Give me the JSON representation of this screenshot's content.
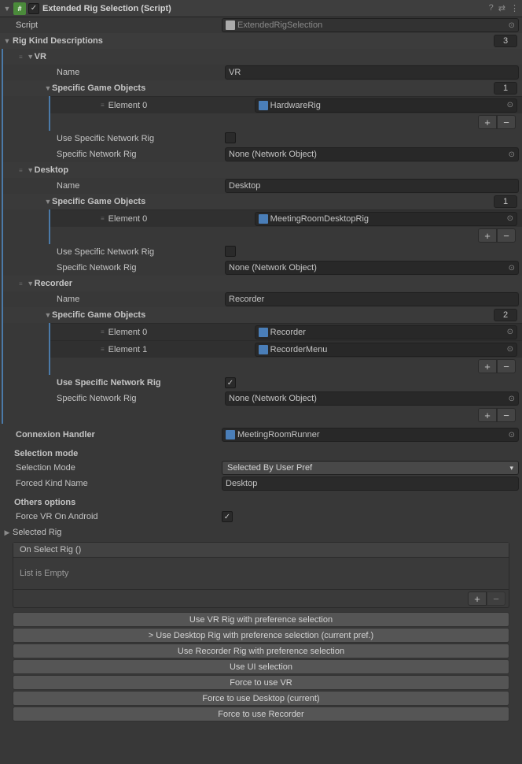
{
  "header": {
    "title": "Extended Rig Selection (Script)"
  },
  "script": {
    "label": "Script",
    "value": "ExtendedRigSelection"
  },
  "rigKinds": {
    "label": "Rig Kind Descriptions",
    "count": "3",
    "items": [
      {
        "title": "VR",
        "name_label": "Name",
        "name_value": "VR",
        "sgo_label": "Specific Game Objects",
        "sgo_count": "1",
        "elements": [
          {
            "label": "Element 0",
            "value": "HardwareRig"
          }
        ],
        "use_net_label": "Use Specific Network Rig",
        "use_net_checked": false,
        "net_label": "Specific Network Rig",
        "net_value": "None (Network Object)"
      },
      {
        "title": "Desktop",
        "name_label": "Name",
        "name_value": "Desktop",
        "sgo_label": "Specific Game Objects",
        "sgo_count": "1",
        "elements": [
          {
            "label": "Element 0",
            "value": "MeetingRoomDesktopRig"
          }
        ],
        "use_net_label": "Use Specific Network Rig",
        "use_net_checked": false,
        "net_label": "Specific Network Rig",
        "net_value": "None (Network Object)"
      },
      {
        "title": "Recorder",
        "name_label": "Name",
        "name_value": "Recorder",
        "sgo_label": "Specific Game Objects",
        "sgo_count": "2",
        "elements": [
          {
            "label": "Element 0",
            "value": "Recorder"
          },
          {
            "label": "Element 1",
            "value": "RecorderMenu"
          }
        ],
        "use_net_label": "Use Specific Network Rig",
        "use_net_checked": true,
        "net_label": "Specific Network Rig",
        "net_value": "None (Network Object)"
      }
    ]
  },
  "connexion": {
    "label": "Connexion Handler",
    "value": "MeetingRoomRunner"
  },
  "selection": {
    "heading": "Selection mode",
    "mode_label": "Selection Mode",
    "mode_value": "Selected By User Pref",
    "forced_label": "Forced Kind Name",
    "forced_value": "Desktop"
  },
  "others": {
    "heading": "Others options",
    "forceVR_label": "Force VR On Android",
    "forceVR_checked": true
  },
  "selectedRig": {
    "label": "Selected Rig"
  },
  "event": {
    "header": "On Select Rig ()",
    "empty": "List is Empty"
  },
  "buttons": {
    "b1": "Use VR Rig with preference selection",
    "b2": "> Use Desktop Rig with preference selection (current pref.)",
    "b3": "Use Recorder Rig with preference selection",
    "b4": "Use UI selection",
    "b5": "Force to use VR",
    "b6": "Force to use Desktop  (current)",
    "b7": "Force to use Recorder"
  }
}
